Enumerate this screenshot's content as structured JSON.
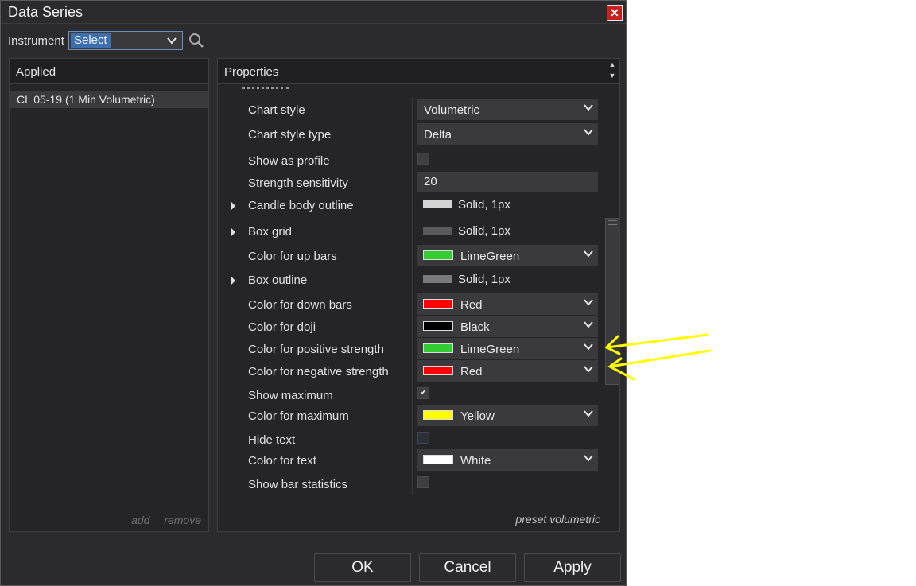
{
  "window": {
    "title": "Data Series",
    "close_icon": "close-icon"
  },
  "instrument": {
    "label": "Instrument",
    "value": "Select",
    "search_icon": "search-icon"
  },
  "applied": {
    "header": "Applied",
    "items": [
      {
        "label": "CL 05-19 (1 Min Volumetric)",
        "selected": true
      }
    ],
    "add_label": "add",
    "remove_label": "remove"
  },
  "properties": {
    "header": "Properties",
    "rows": [
      {
        "label": "Chart style",
        "type": "dropdown",
        "value": "Volumetric"
      },
      {
        "label": "Chart style type",
        "type": "dropdown",
        "value": "Delta"
      },
      {
        "label": "Show as profile",
        "type": "checkbox",
        "checked": false
      },
      {
        "label": "Strength sensitivity",
        "type": "text",
        "value": "20"
      },
      {
        "label": "Candle body outline",
        "type": "stroke",
        "expandable": true,
        "value": "Solid, 1px",
        "color": "#d4d4d4"
      },
      {
        "label": "Box grid",
        "type": "stroke",
        "expandable": true,
        "value": "Solid, 1px",
        "color": "#5a5a5a"
      },
      {
        "label": "Color for up bars",
        "type": "color",
        "value": "LimeGreen",
        "color": "#32cd32"
      },
      {
        "label": "Box outline",
        "type": "stroke",
        "expandable": true,
        "value": "Solid, 1px",
        "color": "#7a7a7a"
      },
      {
        "label": "Color for down bars",
        "type": "color",
        "value": "Red",
        "color": "#ff0000"
      },
      {
        "label": "Color for doji",
        "type": "color",
        "value": "Black",
        "color": "#000000"
      },
      {
        "label": "Color for positive strength",
        "type": "color",
        "value": "LimeGreen",
        "color": "#32cd32"
      },
      {
        "label": "Color for negative strength",
        "type": "color",
        "value": "Red",
        "color": "#ff0000"
      },
      {
        "label": "Show maximum",
        "type": "checkbox",
        "checked": true,
        "check_mark": "✔"
      },
      {
        "label": "Color for maximum",
        "type": "color",
        "value": "Yellow",
        "color": "#ffff00"
      },
      {
        "label": "Hide text",
        "type": "checkbox",
        "checked": false
      },
      {
        "label": "Color for text",
        "type": "color",
        "value": "White",
        "color": "#ffffff"
      },
      {
        "label": "Show bar statistics",
        "type": "checkbox",
        "checked": false
      }
    ],
    "footer": "preset volumetric"
  },
  "buttons": {
    "ok": "OK",
    "cancel": "Cancel",
    "apply": "Apply"
  },
  "annotation": {
    "arrow_color": "#ffff00"
  }
}
